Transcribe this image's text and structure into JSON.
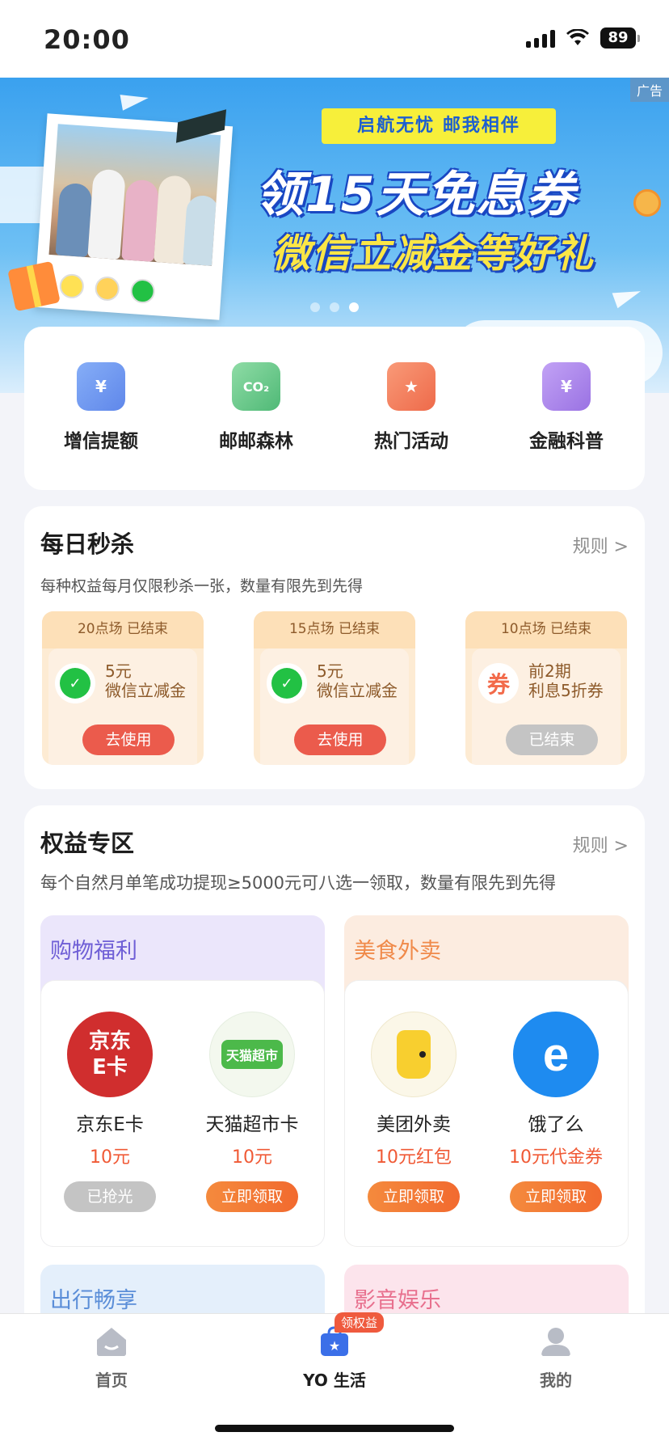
{
  "status": {
    "time": "20:00",
    "battery": "89"
  },
  "banner": {
    "ad_tag": "广告",
    "slogan": "启航无忧 邮我相伴",
    "headline1": "领15天免息券",
    "headline2": "微信立减金等好礼"
  },
  "quick_nav": [
    {
      "label": "增信提额",
      "icon": "wallet-icon",
      "color": "#6f9af0"
    },
    {
      "label": "邮邮森林",
      "icon": "cloud-co2-icon",
      "color": "#6cc58b"
    },
    {
      "label": "热门活动",
      "icon": "bookmark-star-icon",
      "color": "#f27a5a"
    },
    {
      "label": "金融科普",
      "icon": "doc-search-icon",
      "color": "#a37ce8"
    }
  ],
  "flash_sale": {
    "title": "每日秒杀",
    "rule": "规则 >",
    "subtitle": "每种权益每月仅限秒杀一张，数量有限先到先得",
    "items": [
      {
        "head": "20点场   已结束",
        "line1": "5元",
        "line2": "微信立减金",
        "button": "去使用"
      },
      {
        "head": "15点场   已结束",
        "line1": "5元",
        "line2": "微信立减金",
        "button": "去使用"
      },
      {
        "head": "10点场   已结束",
        "line1": "前2期",
        "line2": "利息5折券",
        "button": "已结束",
        "logo_text": "券"
      }
    ]
  },
  "benefits": {
    "title": "权益专区",
    "rule": "规则 >",
    "subtitle": "每个自然月单笔成功提现≥5000元可八选一领取，数量有限先到先得",
    "groups": [
      {
        "title": "购物福利",
        "items": [
          {
            "logo": "京东\nE卡",
            "name": "京东E卡",
            "value": "10元",
            "button": "已抢光"
          },
          {
            "logo": "天猫超市",
            "name": "天猫超市卡",
            "value": "10元",
            "button": "立即领取"
          }
        ]
      },
      {
        "title": "美食外卖",
        "items": [
          {
            "logo": "",
            "name": "美团外卖",
            "value": "10元红包",
            "button": "立即领取"
          },
          {
            "logo": "e",
            "name": "饿了么",
            "value": "10元代金券",
            "button": "立即领取"
          }
        ]
      },
      {
        "title": "出行畅享"
      },
      {
        "title": "影音娱乐"
      }
    ]
  },
  "tabbar": {
    "items": [
      {
        "label": "首页"
      },
      {
        "label": "YO 生活",
        "badge": "领权益"
      },
      {
        "label": "我的"
      }
    ]
  }
}
